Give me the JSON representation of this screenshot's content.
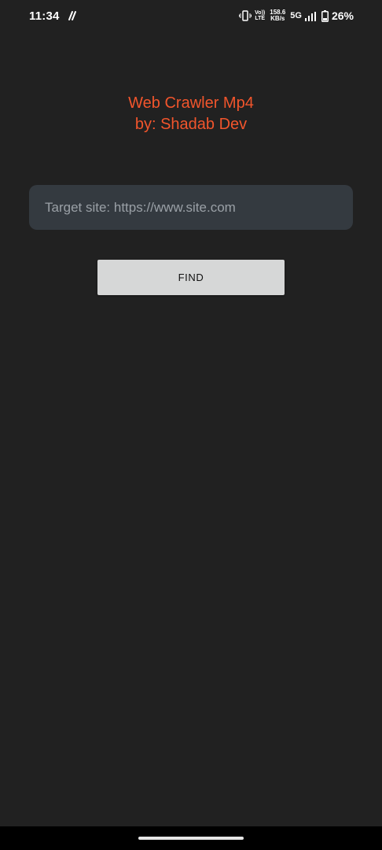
{
  "status_bar": {
    "time": "11:34",
    "volte_top": "Vo))",
    "volte_bottom": "LTE",
    "speed_value": "158.6",
    "speed_unit": "KB/s",
    "network": "5G",
    "battery": "26%"
  },
  "app": {
    "title_line1": "Web Crawler Mp4",
    "title_line2": "by: Shadab Dev",
    "title_color": "#f2552c"
  },
  "form": {
    "url_placeholder": "Target site: https://www.site.com",
    "url_value": "",
    "find_label": "FIND"
  }
}
